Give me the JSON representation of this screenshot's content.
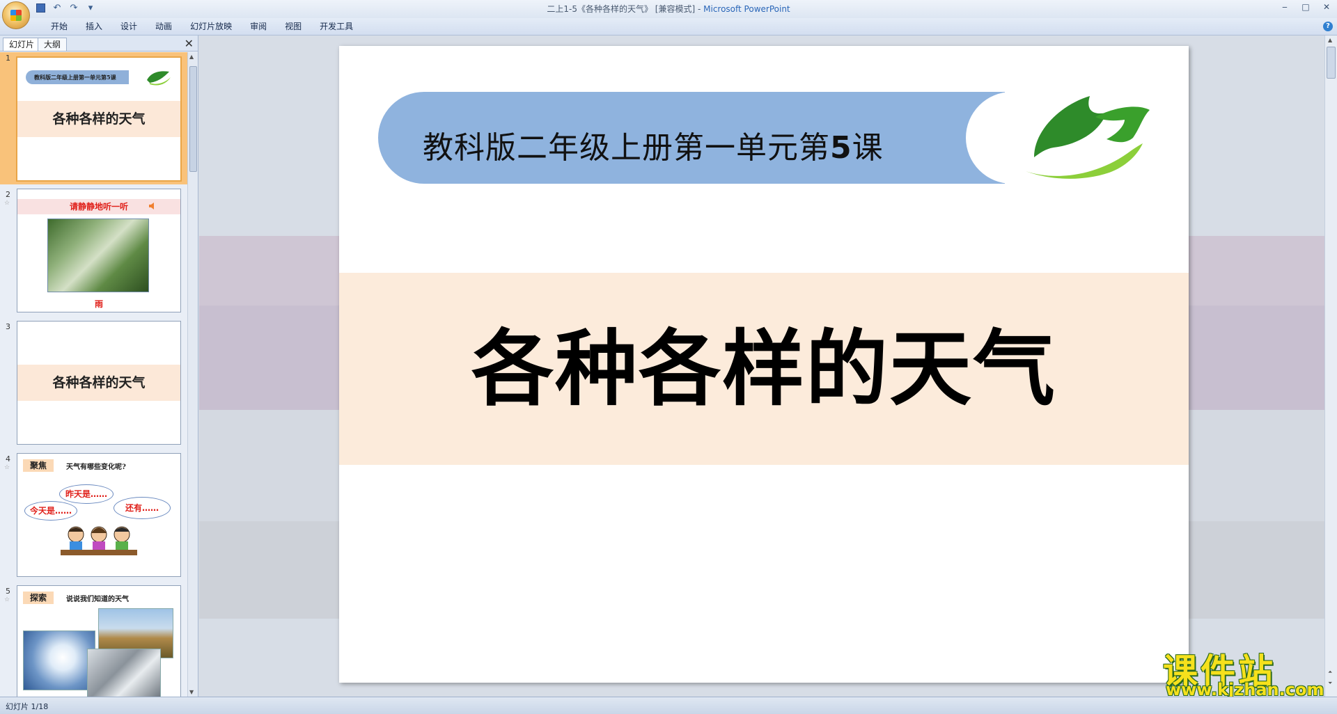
{
  "window": {
    "title_prefix": "二上1-5《各种各样的天气》 [兼容模式] - ",
    "title_app": "Microsoft PowerPoint"
  },
  "ribbon": {
    "tabs": [
      "开始",
      "插入",
      "设计",
      "动画",
      "幻灯片放映",
      "审阅",
      "视图",
      "开发工具"
    ]
  },
  "pane": {
    "tab_slides": "幻灯片",
    "tab_outline": "大纲",
    "close": "✕"
  },
  "thumbnails": [
    {
      "num": "1",
      "banner": "教科版二年级上册第一单元第5课",
      "title": "各种各样的天气"
    },
    {
      "num": "2",
      "star": "☆",
      "heading": "请静静地听一听",
      "caption": "雨"
    },
    {
      "num": "3",
      "title": "各种各样的天气"
    },
    {
      "num": "4",
      "star": "☆",
      "tag": "聚焦",
      "question": "天气有哪些变化呢?",
      "bubble1": "昨天是……",
      "bubble2": "今天是……",
      "bubble3": "还有……"
    },
    {
      "num": "5",
      "star": "☆",
      "tag": "探索",
      "question": "说说我们知道的天气"
    }
  ],
  "slide": {
    "course_text": "教科版二年级上册第一单元第",
    "course_num": "5",
    "course_suffix": "课",
    "title": "各种各样的天气"
  },
  "status": {
    "slide_counter": "幻灯片 1/18"
  },
  "watermark": {
    "brand": "课件站",
    "url": "www.kjzhan.com"
  },
  "colors": {
    "banner_blue": "#8fb3de",
    "title_band": "#fcebdb",
    "leaf_green": "#2e8b2a",
    "selection": "#f9c27a"
  }
}
